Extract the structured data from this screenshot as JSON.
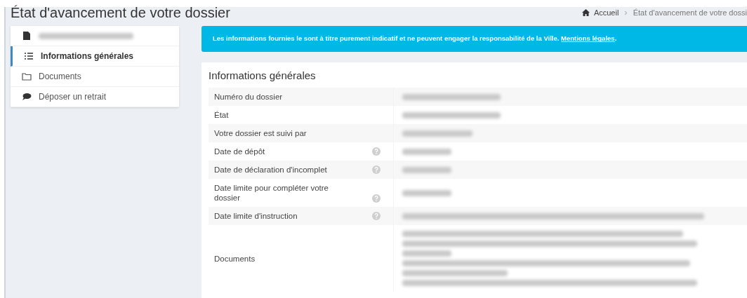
{
  "page_title": "État d'avancement de votre dossier",
  "breadcrumb_separator": "›",
  "breadcrumb": [
    {
      "label": "Accueil",
      "kind": "home"
    },
    {
      "label": "État d'avancement de votre dossi",
      "kind": "current"
    }
  ],
  "sidebar": {
    "items": [
      {
        "kind": "file",
        "selected": false
      },
      {
        "label": "Informations générales",
        "kind": "list",
        "selected": true
      },
      {
        "label": "Documents",
        "kind": "folder",
        "selected": false
      },
      {
        "label": "Déposer un retrait",
        "kind": "comment",
        "selected": false
      }
    ]
  },
  "alert": {
    "text": "Les informations fournies le sont à titre purement indicatif et ne peuvent engager la responsabilité de la Ville.",
    "link": "Mentions légales",
    "tail": "."
  },
  "panel": {
    "title": "Informations générales",
    "rows": [
      {
        "label": "Numéro du dossier",
        "help": false,
        "kind": "text"
      },
      {
        "label": "État",
        "help": false,
        "kind": "text"
      },
      {
        "label": "Votre dossier est suivi par",
        "help": false,
        "kind": "text"
      },
      {
        "label": "Date de dépôt",
        "help": true,
        "kind": "text"
      },
      {
        "label": "Date de déclaration d'incomplet",
        "help": true,
        "kind": "text"
      },
      {
        "label": "Date limite pour compléter votre dossier",
        "help": true,
        "kind": "text"
      },
      {
        "label": "Date limite d'instruction",
        "help": true,
        "kind": "long"
      },
      {
        "label": "Documents",
        "help": false,
        "kind": "list"
      }
    ]
  }
}
